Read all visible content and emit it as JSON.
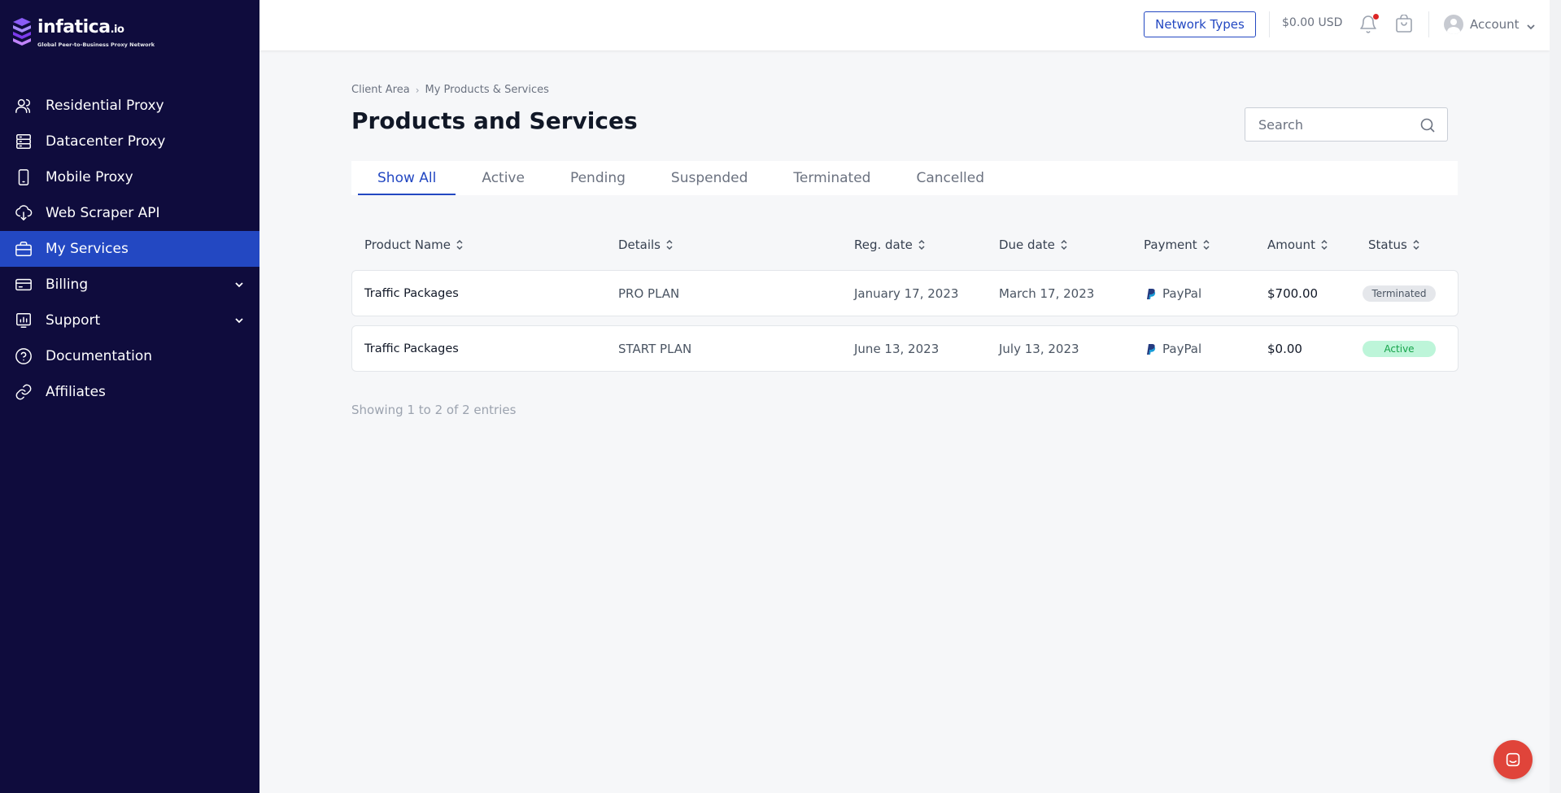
{
  "brand": {
    "name": "infatica",
    "suffix": ".io",
    "tagline": "Global Peer-to-Business Proxy Network",
    "accent": "#2348c2",
    "sidebar_bg": "#0f0c3d"
  },
  "sidebar": {
    "items": [
      {
        "label": "Residential Proxy",
        "icon": "users-icon",
        "active": false,
        "expandable": false
      },
      {
        "label": "Datacenter Proxy",
        "icon": "server-icon",
        "active": false,
        "expandable": false
      },
      {
        "label": "Mobile Proxy",
        "icon": "mobile-icon",
        "active": false,
        "expandable": false
      },
      {
        "label": "Web Scraper API",
        "icon": "cloud-download-icon",
        "active": false,
        "expandable": false
      },
      {
        "label": "My Services",
        "icon": "briefcase-icon",
        "active": true,
        "expandable": false
      },
      {
        "label": "Billing",
        "icon": "credit-card-icon",
        "active": false,
        "expandable": true
      },
      {
        "label": "Support",
        "icon": "chart-support-icon",
        "active": false,
        "expandable": true
      },
      {
        "label": "Documentation",
        "icon": "help-circle-icon",
        "active": false,
        "expandable": false
      },
      {
        "label": "Affiliates",
        "icon": "link-icon",
        "active": false,
        "expandable": false
      }
    ]
  },
  "topbar": {
    "network_types_label": "Network Types",
    "balance": "$0.00 USD",
    "account_label": "Account"
  },
  "breadcrumb": [
    "Client Area",
    "My Products & Services"
  ],
  "page": {
    "title": "Products and Services",
    "search_placeholder": "Search"
  },
  "tabs": [
    "Show All",
    "Active",
    "Pending",
    "Suspended",
    "Terminated",
    "Cancelled"
  ],
  "active_tab": "Show All",
  "table": {
    "columns": [
      "Product Name",
      "Details",
      "Reg. date",
      "Due date",
      "Payment",
      "Amount",
      "Status"
    ],
    "rows": [
      {
        "product": "Traffic Packages",
        "details": "PRO PLAN",
        "reg_date": "January 17, 2023",
        "due_date": "March 17, 2023",
        "payment": "PayPal",
        "amount": "$700.00",
        "status": "Terminated"
      },
      {
        "product": "Traffic Packages",
        "details": "START PLAN",
        "reg_date": "June 13, 2023",
        "due_date": "July 13, 2023",
        "payment": "PayPal",
        "amount": "$0.00",
        "status": "Active"
      }
    ]
  },
  "entries_text": "Showing 1 to 2 of 2 entries",
  "status_colors": {
    "terminated": "#e5e7eb",
    "active": "#bdf5d9"
  },
  "chat_button_color": "#e0443a"
}
